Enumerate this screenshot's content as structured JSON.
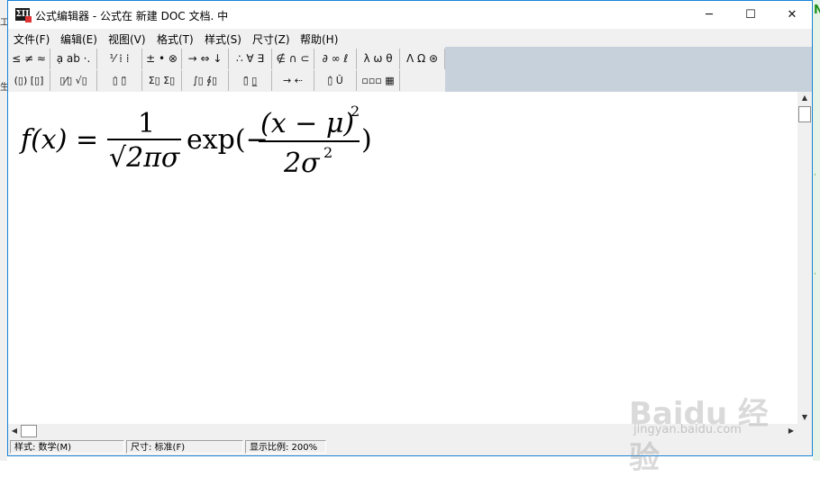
{
  "window": {
    "title": "公式编辑器 - 公式在 新建 DOC 文档. 中",
    "icon": "equation-editor-icon",
    "controls": {
      "minimize": "─",
      "maximize": "☐",
      "close": "✕"
    }
  },
  "menu": [
    "文件(F)",
    "编辑(E)",
    "视图(V)",
    "格式(T)",
    "样式(S)",
    "尺寸(Z)",
    "帮助(H)"
  ],
  "toolbar": {
    "row1": [
      "≤ ≠ ≈",
      "ạ ab ·.",
      "⅟ ⁞ ⁞",
      "± • ⊗",
      "→ ⇔ ↓",
      "∴ ∀ ∃",
      "∉ ∩ ⊂",
      "∂ ∞ ℓ",
      "λ ω θ",
      "Λ Ω ⊛"
    ],
    "row2": [
      "(▯) [▯]",
      "▯⁄▯ √▯",
      "▯̇ ▯̈",
      "Σ▯ Σ▯",
      "∫▯ ∮▯",
      "▯̄ ▯̲",
      "→ ⇠",
      "▯̂ Ǔ",
      "▫▫▫ ▦"
    ]
  },
  "equation": {
    "lhs": "f(x) =",
    "numerator": "1",
    "denominator": "√2πσ",
    "exp": "exp(−",
    "inner_num": "(x − μ)",
    "inner_num_power": "2",
    "inner_den": "2σ",
    "inner_den_power": "2",
    "close": ")"
  },
  "status": {
    "style": "样式: 数学(M)",
    "size": "尺寸: 标准(F)",
    "zoom": "显示比例: 200%"
  },
  "watermark": {
    "logo": "Baidu 经验",
    "url": "jingyan.baidu.com"
  },
  "accent_color": "#1883d7"
}
